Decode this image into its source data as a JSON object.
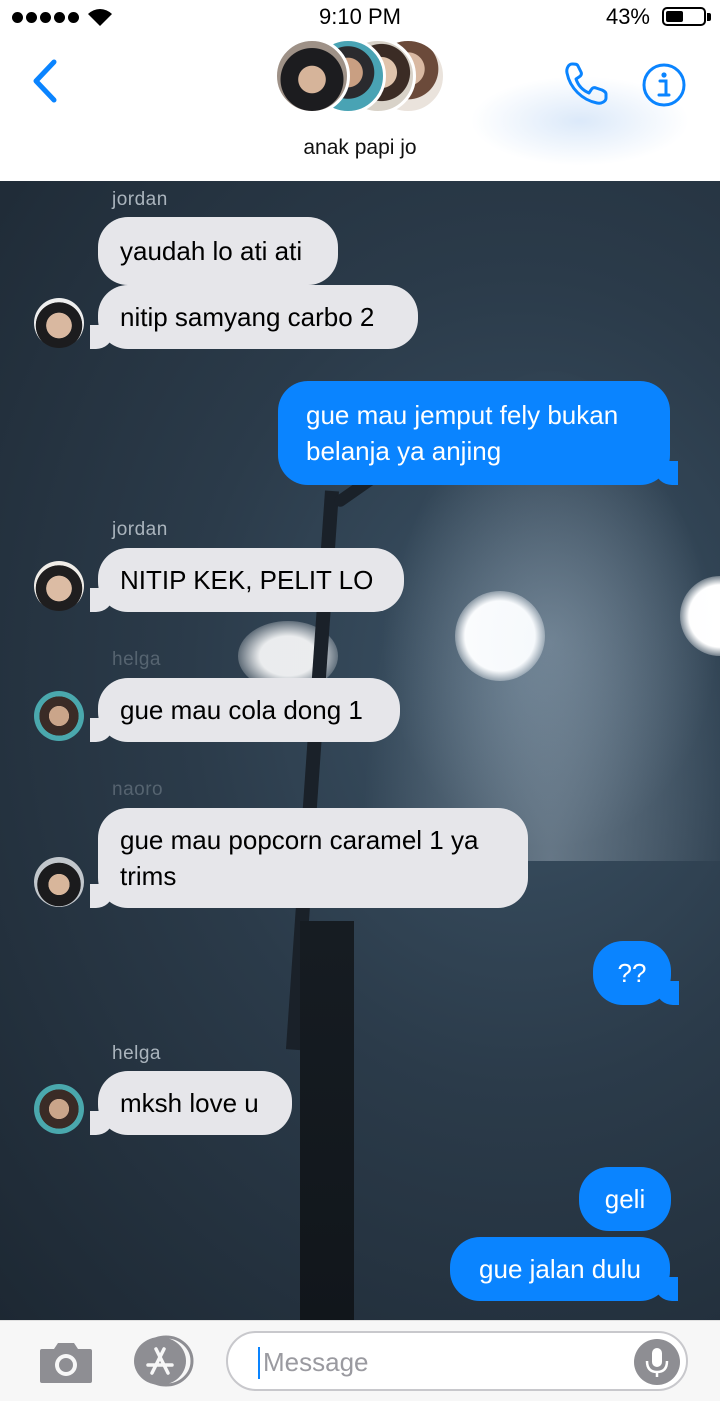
{
  "status_bar": {
    "time": "9:10 PM",
    "battery_percent": "43%",
    "battery_level": 0.43,
    "signal_dots": 5,
    "icons": [
      "signal-dots-icon",
      "wifi-icon",
      "battery-icon"
    ]
  },
  "header": {
    "group_name": "anak papi jo",
    "icons": [
      "back-chevron-icon",
      "phone-icon",
      "info-icon"
    ],
    "avatar_count": 4
  },
  "messages": [
    {
      "sender": "jordan",
      "direction": "in",
      "text": "yaudah lo ati ati"
    },
    {
      "direction": "in",
      "text": "nitip samyang carbo 2",
      "avatar": "jordan"
    },
    {
      "direction": "out",
      "text": "gue mau jemput fely bukan belanja ya anjing"
    },
    {
      "sender": "jordan",
      "direction": "in",
      "text": "NITIP KEK, PELIT LO",
      "avatar": "jordan"
    },
    {
      "sender": "helga",
      "direction": "in",
      "text": "gue mau cola dong 1",
      "avatar": "helga"
    },
    {
      "sender": "naoro",
      "direction": "in",
      "text": "gue mau popcorn caramel 1 ya trims",
      "avatar": "naoro"
    },
    {
      "direction": "out",
      "text": "??"
    },
    {
      "sender": "helga",
      "direction": "in",
      "text": "mksh love u",
      "avatar": "helga"
    },
    {
      "direction": "out",
      "text": "geli"
    },
    {
      "direction": "out",
      "text": "gue jalan dulu"
    }
  ],
  "input_bar": {
    "placeholder": "Message",
    "icons": [
      "camera-icon",
      "app-store-icon",
      "microphone-icon"
    ]
  },
  "colors": {
    "accent": "#0a84ff",
    "incoming_bubble": "#e6e6ea",
    "outgoing_bubble": "#0a84ff"
  }
}
